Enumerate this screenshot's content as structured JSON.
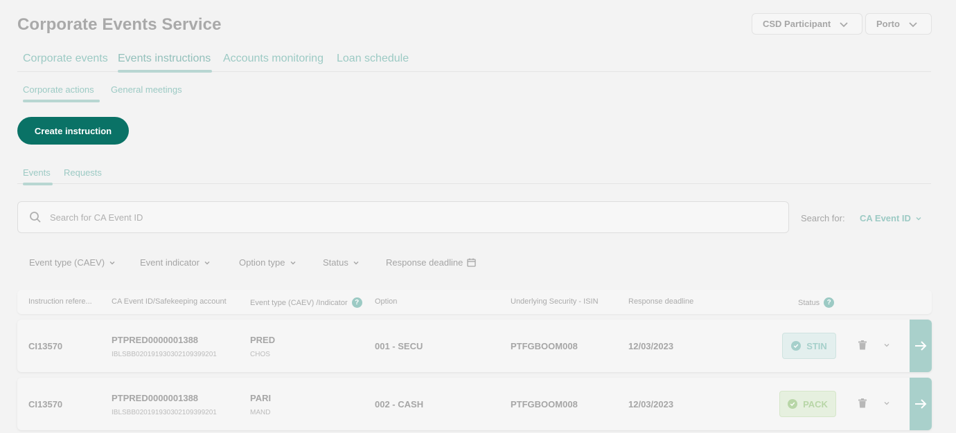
{
  "header": {
    "title": "Corporate Events Service",
    "participant_select": "CSD Participant",
    "location_select": "Porto"
  },
  "main_tabs": [
    "Corporate events",
    "Events instructions",
    "Accounts monitoring",
    "Loan schedule"
  ],
  "active_main_tab": "Events instructions",
  "sub_tabs": [
    "Corporate actions",
    "General meetings"
  ],
  "active_sub_tab": "Corporate actions",
  "create_button": "Create instruction",
  "list_tabs": [
    "Events",
    "Requests"
  ],
  "active_list_tab": "Events",
  "search": {
    "placeholder": "Search for CA Event ID",
    "search_for_label": "Search for:",
    "search_for_value": "CA Event ID"
  },
  "filters": [
    "Event type (CAEV)",
    "Event indicator",
    "Option type",
    "Status",
    "Response deadline"
  ],
  "table": {
    "columns": [
      "Instruction refere...",
      "CA Event ID/Safekeeping account",
      "Event type (CAEV) /Indicator",
      "Option",
      "Underlying Security - ISIN",
      "Response deadline",
      "Status"
    ],
    "rows": [
      {
        "ref": "CI13570",
        "event_id": "PTPRED0000001388",
        "account": "IBLSBB020191930302109399201",
        "event_type": "PRED",
        "indicator": "CHOS",
        "option": "001 - SECU",
        "isin": "PTFGBOOM008",
        "deadline": "12/03/2023",
        "status": "STIN"
      },
      {
        "ref": "CI13570",
        "event_id": "PTPRED0000001388",
        "account": "IBLSBB020191930302109399201",
        "event_type": "PARI",
        "indicator": "MAND",
        "option": "002 - CASH",
        "isin": "PTFGBOOM008",
        "deadline": "12/03/2023",
        "status": "PACK"
      }
    ]
  },
  "colors": {
    "primary": "#0a7266",
    "accent_light": "#9ccac4",
    "status_stin": "#a6d0cb",
    "status_pack": "#b8d6a7",
    "background": "#f3f3f3"
  }
}
